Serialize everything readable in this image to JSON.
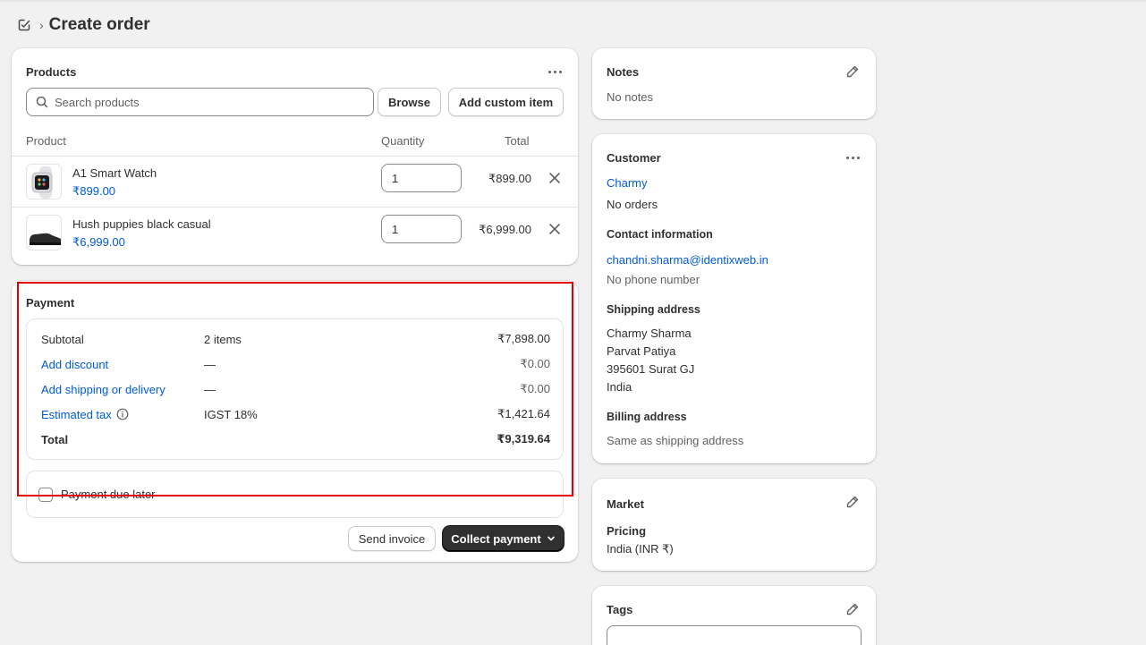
{
  "header": {
    "title": "Create order"
  },
  "products": {
    "title": "Products",
    "search_placeholder": "Search products",
    "browse_label": "Browse",
    "custom_item_label": "Add custom item",
    "columns": {
      "product": "Product",
      "quantity": "Quantity",
      "total": "Total"
    },
    "items": [
      {
        "name": "A1 Smart Watch",
        "price": "₹899.00",
        "quantity": "1",
        "total": "₹899.00"
      },
      {
        "name": "Hush puppies black casual",
        "price": "₹6,999.00",
        "quantity": "1",
        "total": "₹6,999.00"
      }
    ]
  },
  "payment": {
    "title": "Payment",
    "rows": [
      {
        "label": "Subtotal",
        "mid": "2 items",
        "amount": "₹7,898.00"
      },
      {
        "label": "Add discount",
        "mid": "—",
        "amount": "₹0.00"
      },
      {
        "label": "Add shipping or delivery",
        "mid": "—",
        "amount": "₹0.00"
      },
      {
        "label": "Estimated tax",
        "mid": "IGST 18%",
        "amount": "₹1,421.64"
      },
      {
        "label": "Total",
        "mid": "",
        "amount": "₹9,319.64"
      }
    ],
    "due_later_label": "Payment due later",
    "send_invoice_label": "Send invoice",
    "collect_payment_label": "Collect payment"
  },
  "notes": {
    "title": "Notes",
    "value": "No notes"
  },
  "customer": {
    "title": "Customer",
    "name": "Charmy",
    "orders": "No orders",
    "contact_title": "Contact information",
    "email": "chandni.sharma@identixweb.in",
    "phone": "No phone number",
    "shipping_title": "Shipping address",
    "shipping_lines": [
      "Charmy Sharma",
      "Parvat Patiya",
      "395601 Surat GJ",
      "India"
    ],
    "billing_title": "Billing address",
    "billing_value": "Same as shipping address"
  },
  "market": {
    "title": "Market",
    "pricing_label": "Pricing",
    "pricing_value": "India (INR ₹)"
  },
  "tags": {
    "title": "Tags",
    "value": ""
  },
  "colors": {
    "accent": "#303030",
    "link": "#005bd3",
    "highlight": "#e00000",
    "background": "#f1f1f1"
  }
}
